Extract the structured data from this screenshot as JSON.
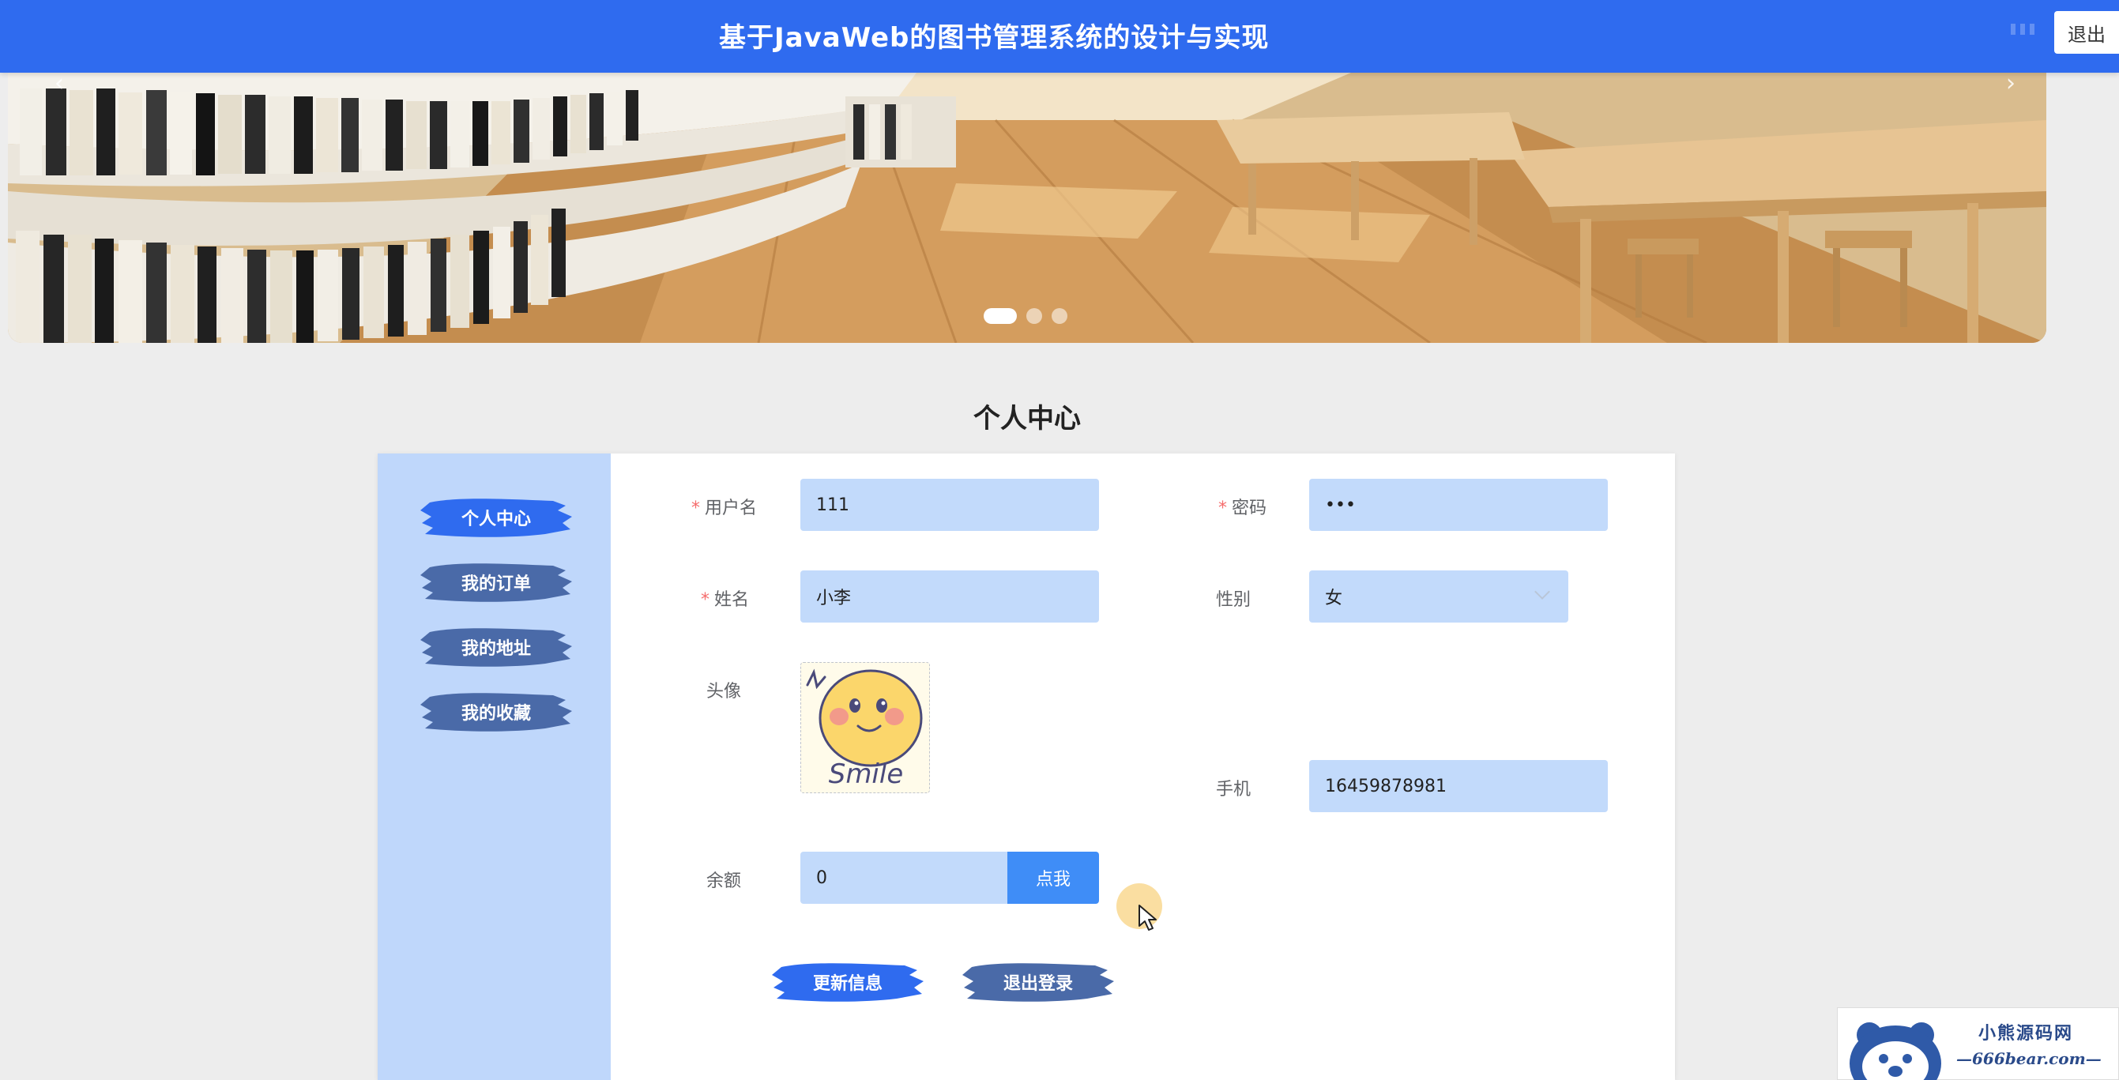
{
  "header": {
    "title": "基于JavaWeb的图书管理系统的设计与实现",
    "logout_label": "退出"
  },
  "carousel": {
    "prev_glyph": "‹",
    "next_glyph": "›",
    "slide_count": 3,
    "active_index": 0
  },
  "page": {
    "title": "个人中心"
  },
  "sidebar": {
    "items": [
      {
        "label": "个人中心",
        "active": true
      },
      {
        "label": "我的订单",
        "active": false
      },
      {
        "label": "我的地址",
        "active": false
      },
      {
        "label": "我的收藏",
        "active": false
      }
    ]
  },
  "form": {
    "username": {
      "label": "用户名",
      "value": "111",
      "required": true
    },
    "password": {
      "label": "密码",
      "value": "•••",
      "required": true
    },
    "name": {
      "label": "姓名",
      "value": "小李",
      "required": true
    },
    "gender": {
      "label": "性别",
      "value": "女"
    },
    "avatar": {
      "label": "头像",
      "image_text": "Smile"
    },
    "phone": {
      "label": "手机",
      "value": "16459878981"
    },
    "balance": {
      "label": "余额",
      "value": "0",
      "topup_label": "点我"
    },
    "required_mark": "*"
  },
  "actions": {
    "update_label": "更新信息",
    "logout_label": "退出登录"
  },
  "watermark": {
    "line1": "小熊源码网",
    "line2": "—666bear.com—"
  },
  "colors": {
    "header_bg": "#2f6bef",
    "sidebar_bg": "#bfd7fb",
    "field_bg": "#c2dafb",
    "brush_active": "#2f6bef",
    "brush_inactive": "#4a6aa8",
    "topup_bg": "#3f8df7",
    "required": "#f56c6c"
  }
}
